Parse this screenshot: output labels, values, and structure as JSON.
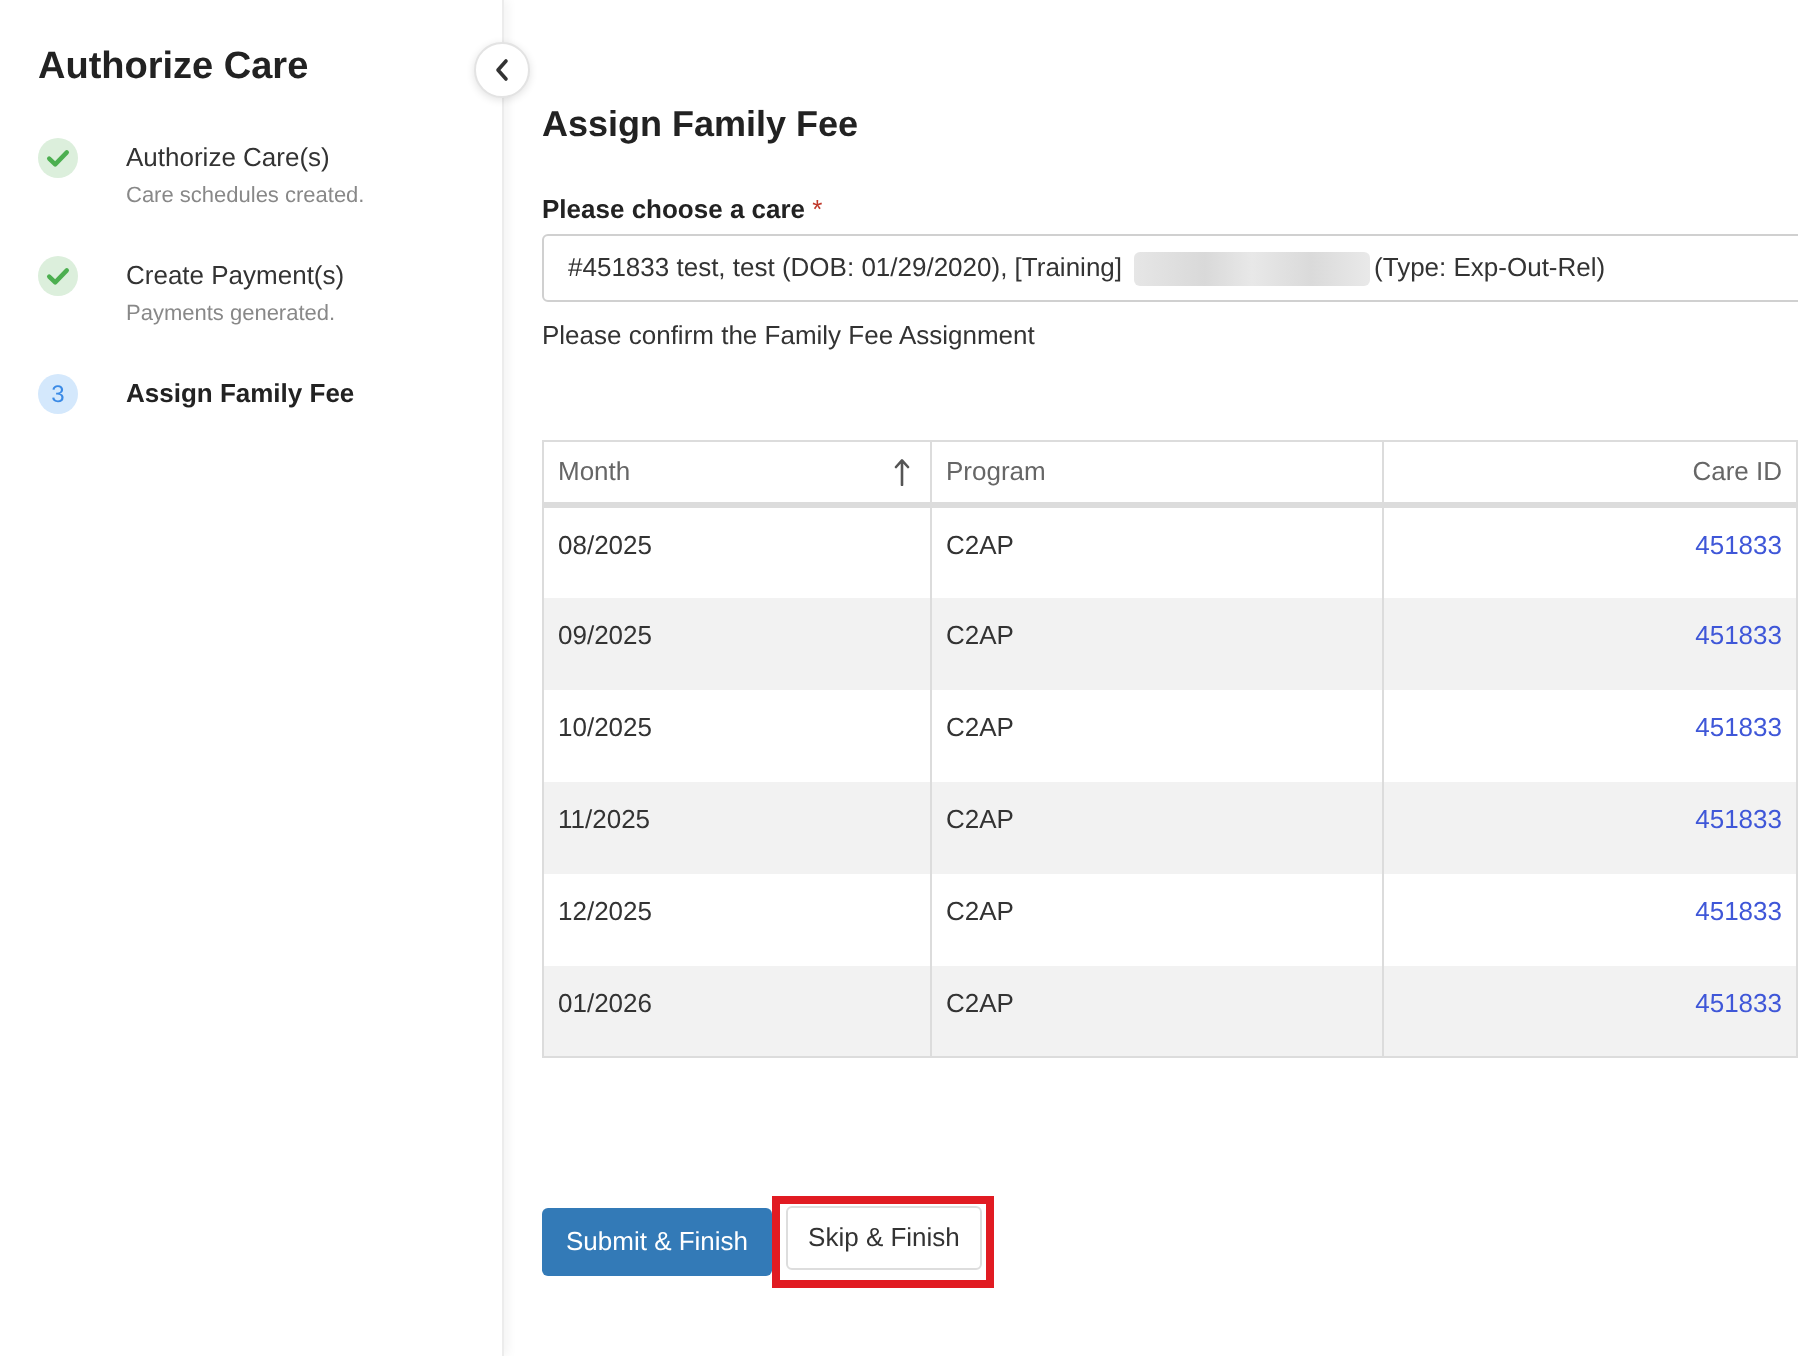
{
  "sidebar": {
    "title": "Authorize Care",
    "steps": [
      {
        "kind": "done",
        "title": "Authorize Care(s)",
        "subtitle": "Care schedules created."
      },
      {
        "kind": "done",
        "title": "Create Payment(s)",
        "subtitle": "Payments generated."
      },
      {
        "kind": "current",
        "number": "3",
        "title": "Assign Family Fee"
      }
    ]
  },
  "main": {
    "title": "Assign Family Fee",
    "care_field": {
      "label": "Please choose a care",
      "required_mark": "*",
      "value_start": "#451833 test, test (DOB: 01/29/2020), [Training]",
      "redacted": true,
      "value_end": "(Type: Exp-Out-Rel)"
    },
    "note": "Please confirm the Family Fee Assignment",
    "table": {
      "columns": [
        {
          "label": "Month",
          "kind": "text",
          "sorted": true
        },
        {
          "label": "Program",
          "kind": "text",
          "sorted": false
        },
        {
          "label": "Care ID",
          "kind": "link",
          "sorted": false
        }
      ],
      "rows": [
        {
          "month": "08/2025",
          "program": "C2AP",
          "care_id": "451833"
        },
        {
          "month": "09/2025",
          "program": "C2AP",
          "care_id": "451833"
        },
        {
          "month": "10/2025",
          "program": "C2AP",
          "care_id": "451833"
        },
        {
          "month": "11/2025",
          "program": "C2AP",
          "care_id": "451833"
        },
        {
          "month": "12/2025",
          "program": "C2AP",
          "care_id": "451833"
        },
        {
          "month": "01/2026",
          "program": "C2AP",
          "care_id": "451833"
        }
      ]
    },
    "buttons": [
      {
        "label": "Submit & Finish",
        "kind": "primary",
        "highlighted": false
      },
      {
        "label": "Skip & Finish",
        "kind": "secondary",
        "highlighted": true
      }
    ]
  }
}
